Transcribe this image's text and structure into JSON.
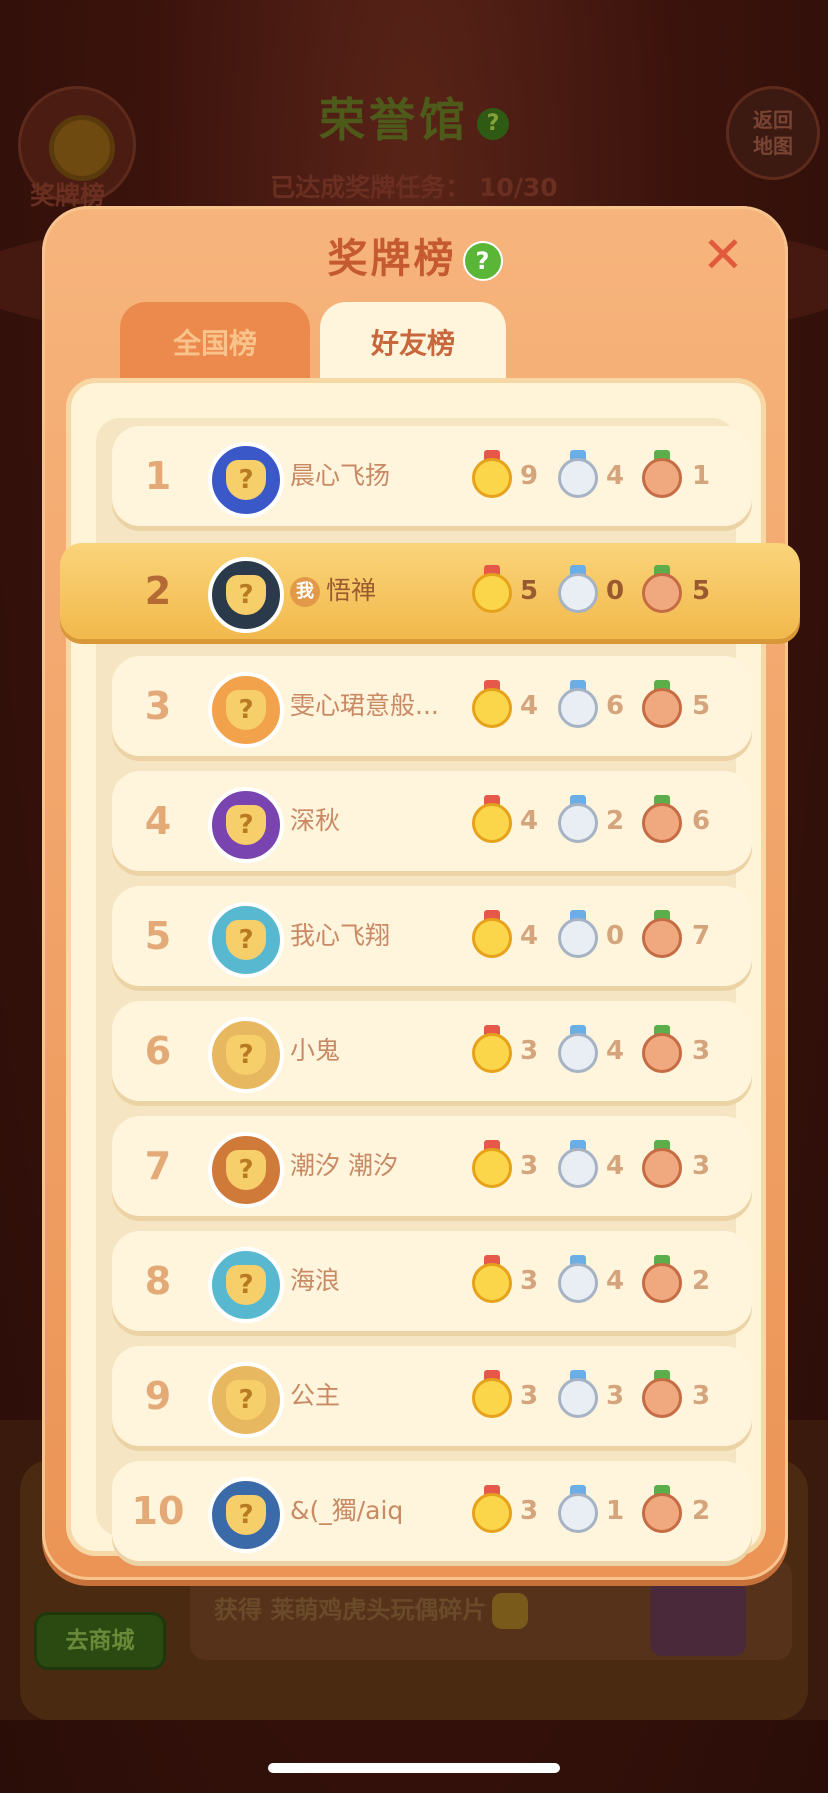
{
  "background": {
    "title": "荣誉馆",
    "title_help": "?",
    "progress": "已达成奖牌任务： 10/30",
    "left_button_label": "奖牌榜",
    "right_button_label": "返回地图",
    "shop_button": "去商城",
    "reward_text": "获得 莱萌鸡虎头玩偶碎片"
  },
  "modal": {
    "title": "奖牌榜",
    "help": "?",
    "close": "✕",
    "tabs": [
      {
        "label": "全国榜",
        "active": false
      },
      {
        "label": "好友榜",
        "active": true
      }
    ]
  },
  "me_badge": "我",
  "rows": [
    {
      "rank": "1",
      "name": "晨心飞扬",
      "gold": "9",
      "silver": "4",
      "bronze": "1",
      "me": false,
      "avatar_color": "#3b58c8"
    },
    {
      "rank": "2",
      "name": "悟禅",
      "gold": "5",
      "silver": "0",
      "bronze": "5",
      "me": true,
      "avatar_color": "#2a3a4a"
    },
    {
      "rank": "3",
      "name": "雯心珺意般...",
      "gold": "4",
      "silver": "6",
      "bronze": "5",
      "me": false,
      "avatar_color": "#f2a24a"
    },
    {
      "rank": "4",
      "name": "深秋",
      "gold": "4",
      "silver": "2",
      "bronze": "6",
      "me": false,
      "avatar_color": "#7a44b0"
    },
    {
      "rank": "5",
      "name": "我心飞翔",
      "gold": "4",
      "silver": "0",
      "bronze": "7",
      "me": false,
      "avatar_color": "#58b8d0"
    },
    {
      "rank": "6",
      "name": "小鬼",
      "gold": "3",
      "silver": "4",
      "bronze": "3",
      "me": false,
      "avatar_color": "#e8b860"
    },
    {
      "rank": "7",
      "name": "潮汐 潮汐",
      "gold": "3",
      "silver": "4",
      "bronze": "3",
      "me": false,
      "avatar_color": "#d07a3a"
    },
    {
      "rank": "8",
      "name": "海浪",
      "gold": "3",
      "silver": "4",
      "bronze": "2",
      "me": false,
      "avatar_color": "#58b8d0"
    },
    {
      "rank": "9",
      "name": "公主",
      "gold": "3",
      "silver": "3",
      "bronze": "3",
      "me": false,
      "avatar_color": "#e8b860"
    },
    {
      "rank": "10",
      "name": "&(_獨/aiq",
      "gold": "3",
      "silver": "1",
      "bronze": "2",
      "me": false,
      "avatar_color": "#3a6aa8"
    }
  ]
}
